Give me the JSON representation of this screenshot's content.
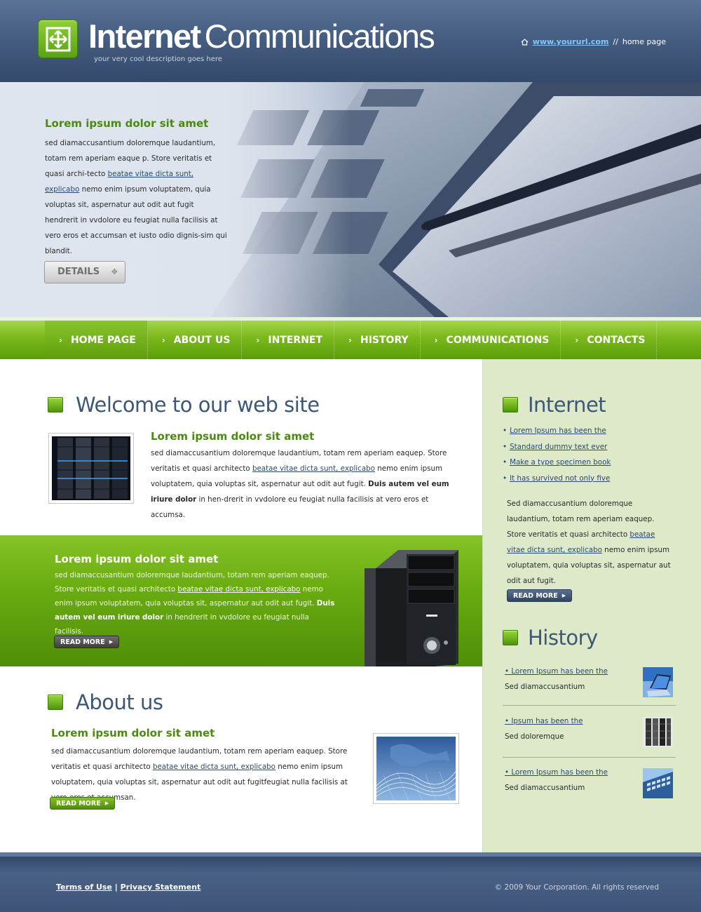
{
  "header": {
    "logo_bold": "Internet",
    "logo_light": "Communications",
    "description": "your very cool description goes here",
    "site_url": "www.yoururl.com",
    "separator": "//",
    "current_page": "home page"
  },
  "hero": {
    "title": "Lorem ipsum dolor sit amet",
    "body_before": "sed diamaccusantium doloremque laudantium, totam rem aperiam eaque p. Store veritatis et quasi archi-tecto ",
    "link": "beatae vitae dicta sunt, explicabo",
    "body_after": " nemo enim ipsum voluptatem, quia voluptas sit, aspernatur aut odit aut fugit hendrerit in vvdolore eu feugiat nulla facilisis at vero eros et accumsan et iusto odio dignis-sim qui blandit.",
    "button": "DETAILS"
  },
  "nav": {
    "items": [
      {
        "label": "HOME PAGE"
      },
      {
        "label": "ABOUT US"
      },
      {
        "label": "INTERNET"
      },
      {
        "label": "HISTORY"
      },
      {
        "label": "COMMUNICATIONS"
      },
      {
        "label": "CONTACTS"
      }
    ]
  },
  "welcome": {
    "heading": "Welcome to our web site",
    "title": "Lorem ipsum dolor sit amet",
    "body_before": "sed diamaccusantium doloremque laudantium, totam rem aperiam eaquep. Store veritatis et quasi architecto ",
    "link": "beatae vitae dicta sunt, explicabo",
    "body_mid": " nemo enim ipsum voluptatem, quia voluptas sit, aspernatur aut odit aut fugit. ",
    "bold": "Duis autem vel eum iriure dolor",
    "body_after": " in hen-drerit in vvdolore eu feugiat nulla facilisis at vero eros et accumsa."
  },
  "promo": {
    "title": "Lorem ipsum dolor sit amet",
    "body_before": "sed diamaccusantium doloremque laudantium, totam rem aperiam eaquep. Store veritatis et quasi architecto ",
    "link": "beatae vitae dicta sunt, explicabo",
    "body_mid": " nemo enim ipsum voluptatem, quia voluptas sit, aspernatur aut odit aut fugit.  ",
    "bold": "Duis autem vel eum iriure dolor",
    "body_after": " in hendrerit in vvdolore eu feugiat nulla facilisis.",
    "read_more": "READ MORE"
  },
  "about": {
    "heading": "About us",
    "title": "Lorem ipsum dolor sit amet",
    "body_before": "sed diamaccusantium doloremque laudantium, totam rem aperiam eaquep. Store veritatis et quasi architecto ",
    "link": "beatae vitae dicta sunt, explicabo",
    "body_after": " nemo enim ipsum voluptatem, quia voluptas sit, aspernatur aut odit aut fugitfeugiat nulla facilisis at vero eros et accumsan.",
    "read_more": "READ MORE"
  },
  "sidebar": {
    "internet": {
      "heading": "Internet",
      "links": [
        {
          "label": "Lorem Ipsum has been the"
        },
        {
          "label": "Standard dummy text ever"
        },
        {
          "label": "Make a type specimen book"
        },
        {
          "label": "It has survived not only five"
        }
      ],
      "body_before": "Sed diamaccusantium doloremque laudantium, totam rem aperiam eaquep. Store veritatis et quasi architecto ",
      "link": "beatae vitae dicta sunt, explicabo",
      "body_after": " nemo enim ipsum voluptatem, quia voluptas sit, aspernatur aut odit aut fugit.",
      "read_more": "READ MORE"
    },
    "history": {
      "heading": "History",
      "items": [
        {
          "link": "Lorem Ipsum has been the",
          "sub": "Sed diamaccusantium"
        },
        {
          "link": "Ipsum has been the",
          "sub": "Sed doloremque"
        },
        {
          "link": "Lorem Ipsum has been the",
          "sub": "Sed diamaccusantium"
        }
      ]
    }
  },
  "footer": {
    "terms": "Terms of Use",
    "divider": "|",
    "privacy": "Privacy Statement",
    "copyright": "© 2009 Your Corporation. All rights reserved"
  },
  "colors": {
    "header_blue": "#465e82",
    "accent_green": "#6aac12",
    "heading_blue": "#3c5778",
    "sidebar_bg": "#dde9c9"
  }
}
